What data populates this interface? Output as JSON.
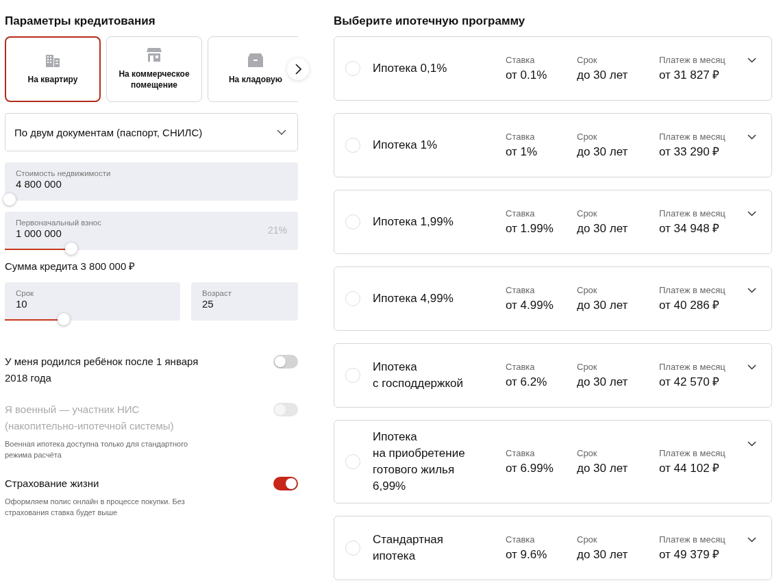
{
  "params": {
    "title": "Параметры кредитования",
    "property_types": [
      {
        "label": "На квартиру",
        "selected": true
      },
      {
        "label": "На коммерческое помещение",
        "selected": false
      },
      {
        "label": "На кладовую",
        "selected": false
      }
    ],
    "document_mode": {
      "value": "По двум документам (паспорт, СНИЛС)"
    },
    "property_cost": {
      "label": "Стоимость недвижимости",
      "value": "4 800 000",
      "level": 0.0
    },
    "down_payment": {
      "label": "Первоначальный взнос",
      "value": "1 000 000",
      "percent": "21%",
      "level": 0.21
    },
    "loan_sum": "Сумма кредита 3 800 000 ₽",
    "term": {
      "label": "Срок",
      "value": "10",
      "level": 0.31
    },
    "age": {
      "label": "Возраст",
      "value": "25"
    },
    "options": [
      {
        "label": "У меня родился ребёнок после 1 января 2018 года",
        "on": false,
        "disabled": false
      },
      {
        "label": "Я военный — участник НИС (накопительно-ипотечной системы)",
        "on": false,
        "disabled": true,
        "note": "Военная ипотека доступна только для стандартного режима расчёта"
      },
      {
        "label": "Страхование жизни",
        "on": true,
        "disabled": false,
        "note": "Оформляем полис онлайн в процессе покупки. Без страхования ставка будет выше"
      }
    ]
  },
  "programs": {
    "title": "Выберите ипотечную программу",
    "items": [
      {
        "name": "Ипотека 0,1%",
        "rate_label": "Ставка",
        "rate": "от 0.1%",
        "term_label": "Срок",
        "term": "до 30 лет",
        "payment_label": "Платеж в месяц",
        "payment": "от 31 827 ₽",
        "selected": false
      },
      {
        "name": "Ипотека 1%",
        "rate_label": "Ставка",
        "rate": "от 1%",
        "term_label": "Срок",
        "term": "до 30 лет",
        "payment_label": "Платеж в месяц",
        "payment": "от 33 290 ₽",
        "selected": false
      },
      {
        "name": "Ипотека 1,99%",
        "rate_label": "Ставка",
        "rate": "от 1.99%",
        "term_label": "Срок",
        "term": "до 30 лет",
        "payment_label": "Платеж в месяц",
        "payment": "от 34 948 ₽",
        "selected": false
      },
      {
        "name": "Ипотека 4,99%",
        "rate_label": "Ставка",
        "rate": "от 4.99%",
        "term_label": "Срок",
        "term": "до 30 лет",
        "payment_label": "Платеж в месяц",
        "payment": "от 40 286 ₽",
        "selected": false
      },
      {
        "name": "Ипотека\nс господдержкой",
        "rate_label": "Ставка",
        "rate": "от 6.2%",
        "term_label": "Срок",
        "term": "до 30 лет",
        "payment_label": "Платеж в месяц",
        "payment": "от 42 570 ₽",
        "selected": false
      },
      {
        "name": "Ипотека\nна приобретение\nготового жилья\n6,99%",
        "rate_label": "Ставка",
        "rate": "от 6.99%",
        "term_label": "Срок",
        "term": "до 30 лет",
        "payment_label": "Платеж в месяц",
        "payment": "от 44 102 ₽",
        "selected": false
      },
      {
        "name": "Стандартная\nипотека",
        "rate_label": "Ставка",
        "rate": "от 9.6%",
        "term_label": "Срок",
        "term": "до 30 лет",
        "payment_label": "Платеж в месяц",
        "payment": "от 49 379 ₽",
        "selected": false
      }
    ]
  }
}
